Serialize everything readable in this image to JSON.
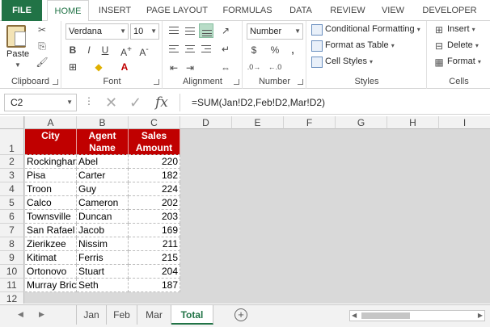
{
  "tabs": [
    "FILE",
    "HOME",
    "INSERT",
    "PAGE LAYOUT",
    "FORMULAS",
    "DATA",
    "REVIEW",
    "VIEW",
    "DEVELOPER"
  ],
  "ribbon": {
    "clipboard": {
      "paste_label": "Paste",
      "group_label": "Clipboard"
    },
    "font": {
      "font_name": "Verdana",
      "font_size": "10",
      "bold": "B",
      "italic": "I",
      "underline": "U",
      "font_color_glyph": "A",
      "group_label": "Font"
    },
    "alignment": {
      "group_label": "Alignment"
    },
    "number": {
      "format": "Number",
      "currency": "$",
      "percent": "%",
      "comma": ",",
      "group_label": "Number"
    },
    "styles": {
      "conditional": "Conditional Formatting",
      "format_table": "Format as Table",
      "cell_styles": "Cell Styles",
      "group_label": "Styles"
    },
    "cells": {
      "insert": "Insert",
      "delete": "Delete",
      "format": "Format",
      "group_label": "Cells"
    }
  },
  "formula_bar": {
    "name_box": "C2",
    "fx": "fx",
    "formula": "=SUM(Jan!D2,Feb!D2,Mar!D2)"
  },
  "columns": [
    "A",
    "B",
    "C",
    "D",
    "E",
    "F",
    "G",
    "H",
    "I"
  ],
  "rows": [
    "1",
    "2",
    "3",
    "4",
    "5",
    "6",
    "7",
    "8",
    "9",
    "10",
    "11",
    "12"
  ],
  "table": {
    "headers": [
      "City",
      "Agent Name",
      "Sales Amount"
    ],
    "rows": [
      [
        "Rockinghar",
        "Abel",
        "220"
      ],
      [
        "Pisa",
        "Carter",
        "182"
      ],
      [
        "Troon",
        "Guy",
        "224"
      ],
      [
        "Calco",
        "Cameron",
        "202"
      ],
      [
        "Townsville",
        "Duncan",
        "203"
      ],
      [
        "San Rafael",
        "Jacob",
        "169"
      ],
      [
        "Zierikzee",
        "Nissim",
        "211"
      ],
      [
        "Kitimat",
        "Ferris",
        "215"
      ],
      [
        "Ortonovo",
        "Stuart",
        "204"
      ],
      [
        "Murray Bric",
        "Seth",
        "187"
      ]
    ]
  },
  "sheet_tabs": [
    "Jan",
    "Feb",
    "Mar",
    "Total"
  ],
  "active_sheet": "Total",
  "colors": {
    "accent": "#217346",
    "header_fill": "#c00000"
  }
}
